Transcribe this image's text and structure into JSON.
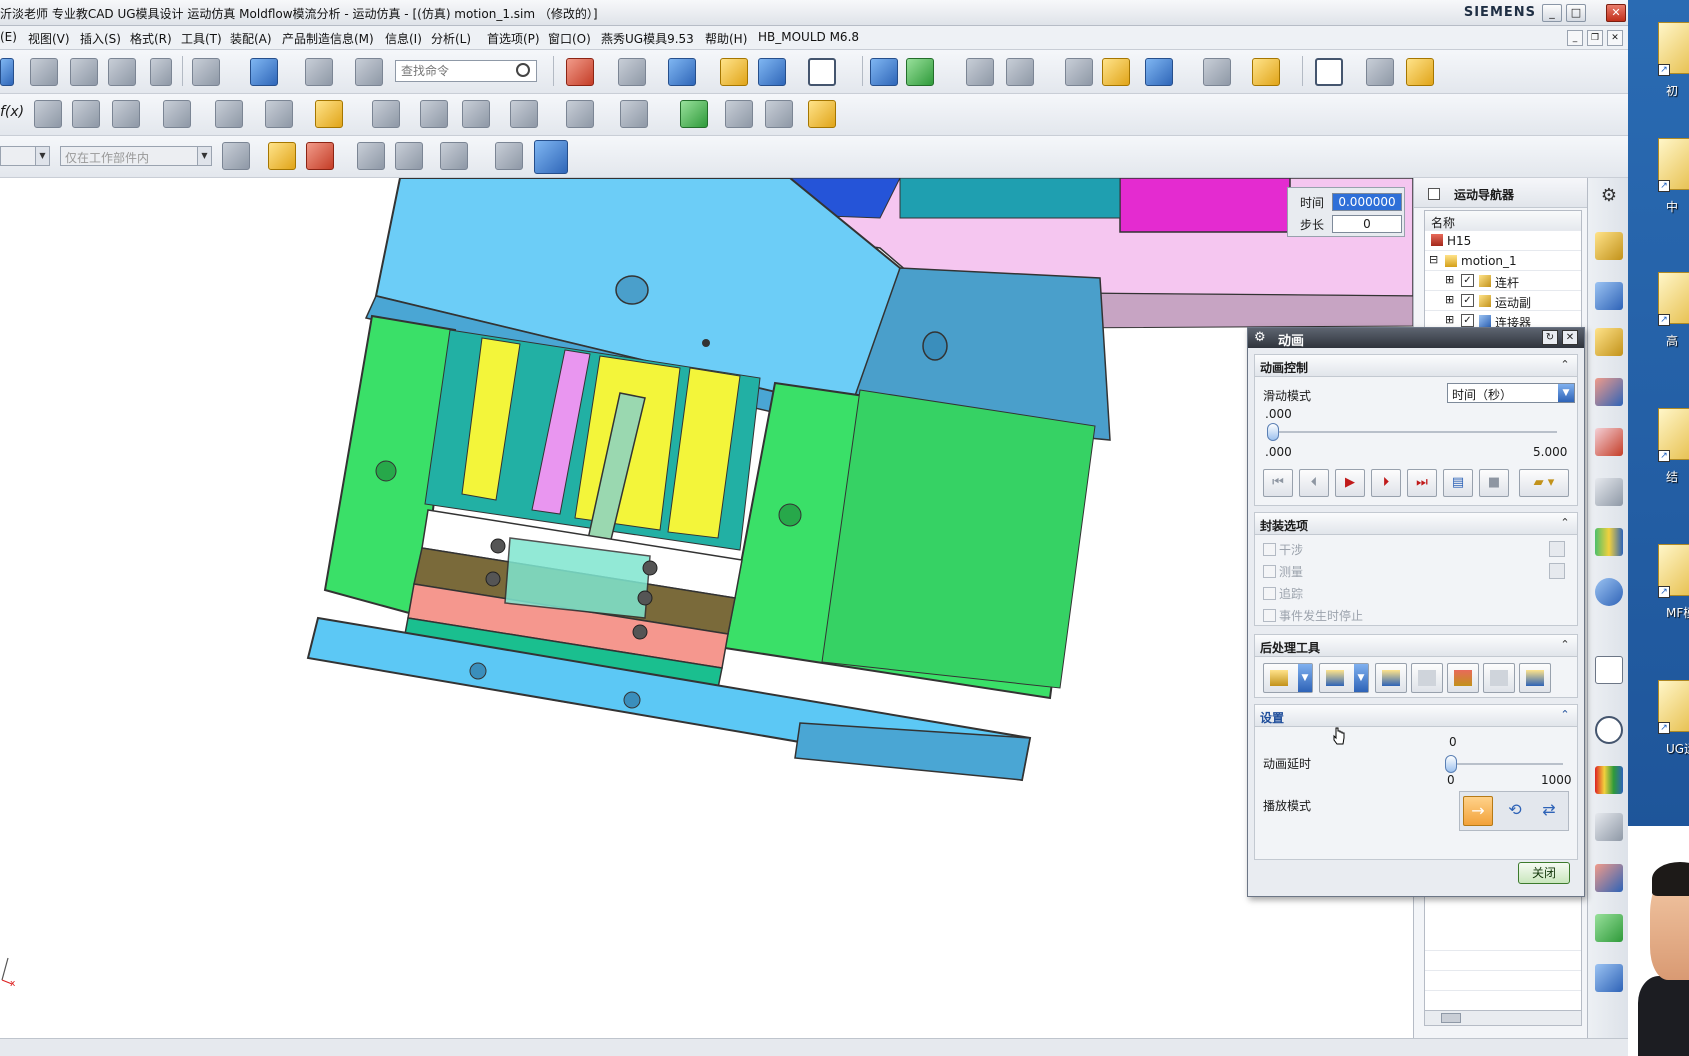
{
  "window": {
    "title": "沂淡老师 专业教CAD UG模具设计 运动仿真 Moldflow模流分析 - 运动仿真 - [(仿真) motion_1.sim （修改的）]",
    "brand": "SIEMENS"
  },
  "menu": {
    "items": [
      "(E)",
      "视图(V)",
      "插入(S)",
      "格式(R)",
      "工具(T)",
      "装配(A)",
      "产品制造信息(M)",
      "信息(I)",
      "分析(L)",
      "首选项(P)",
      "窗口(O)",
      "燕秀UG模具9.53",
      "帮助(H)",
      "HB_MOULD M6.8"
    ]
  },
  "toolbar": {
    "search_placeholder": "查找命令",
    "fx_label": "f(x)",
    "filter_scope": "仅在工作部件内"
  },
  "timepanel": {
    "time_label": "时间",
    "time_value": "0.000000",
    "step_label": "步长",
    "step_value": "0"
  },
  "navigator": {
    "title": "运动导航器",
    "column_name": "名称",
    "items": [
      {
        "label": "H15",
        "expander": "",
        "checkbox": false
      },
      {
        "label": "motion_1",
        "expander": "⊟",
        "checkbox": false
      },
      {
        "label": "连杆",
        "expander": "⊞",
        "checkbox": true
      },
      {
        "label": "运动副",
        "expander": "⊞",
        "checkbox": true
      },
      {
        "label": "连接器",
        "expander": "⊞",
        "checkbox": true
      }
    ]
  },
  "dialog": {
    "title": "动画",
    "anim_control": {
      "header": "动画控制",
      "slide_mode_label": "滑动模式",
      "slide_mode_value": "时间（秒）",
      "current_value": ".000",
      "min_label": ".000",
      "max_label": "5.000",
      "position_fraction": 0.0
    },
    "packaging": {
      "header": "封装选项",
      "options": [
        "干涉",
        "测量",
        "追踪",
        "事件发生时停止"
      ]
    },
    "postprocess": {
      "header": "后处理工具"
    },
    "settings": {
      "header": "设置",
      "delay_label": "动画延时",
      "delay_value": "0",
      "delay_min": "0",
      "delay_max": "1000",
      "playback_label": "播放模式"
    },
    "close_label": "关闭"
  },
  "desktop": {
    "icons": [
      "初",
      "中",
      "高",
      "结",
      "MF模",
      "UG运"
    ]
  },
  "colors": {
    "mold_blue": "#5cc8f5",
    "mold_green": "#3ae068",
    "mold_yellow": "#f3f53a",
    "mold_pink": "#f5c6f0",
    "mold_magenta": "#e42bd0",
    "accent": "#2e6fd8"
  }
}
